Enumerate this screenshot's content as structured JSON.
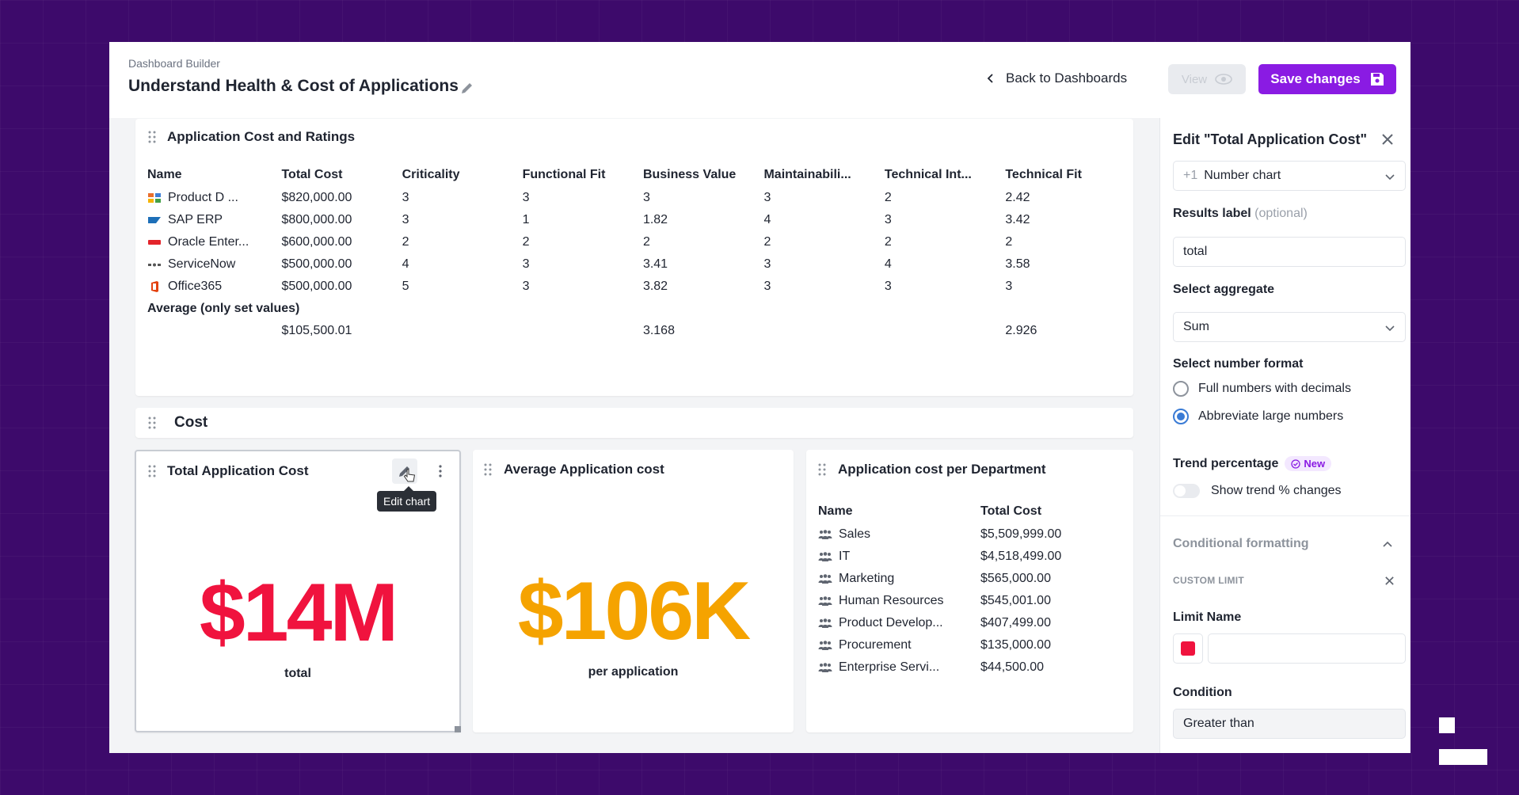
{
  "header": {
    "breadcrumb": "Dashboard Builder",
    "title": "Understand Health & Cost of Applications",
    "back_label": "Back to Dashboards",
    "view_label": "View",
    "save_label": "Save changes"
  },
  "ratings_panel": {
    "title": "Application Cost and Ratings",
    "columns": [
      "Name",
      "Total Cost",
      "Criticality",
      "Functional Fit",
      "Business Value",
      "Maintainabili...",
      "Technical Int...",
      "Technical Fit"
    ],
    "rows": [
      {
        "logo": "product-logo",
        "cells": [
          "Product D ...",
          "$820,000.00",
          "3",
          "3",
          "3",
          "3",
          "2",
          "2.42"
        ]
      },
      {
        "logo": "sap-logo",
        "cells": [
          "SAP ERP",
          "$800,000.00",
          "3",
          "1",
          "1.82",
          "4",
          "3",
          "3.42"
        ]
      },
      {
        "logo": "oracle-logo",
        "cells": [
          "Oracle Enter...",
          "$600,000.00",
          "2",
          "2",
          "2",
          "2",
          "2",
          "2"
        ]
      },
      {
        "logo": "servicenow-logo",
        "cells": [
          "ServiceNow",
          "$500,000.00",
          "4",
          "3",
          "3.41",
          "3",
          "4",
          "3.58"
        ]
      },
      {
        "logo": "office365-logo",
        "cells": [
          "Office365",
          "$500,000.00",
          "5",
          "3",
          "3.82",
          "3",
          "3",
          "3"
        ]
      }
    ],
    "average_label": "Average (only set values)",
    "average_values": [
      "",
      "$105,500.01",
      "",
      "",
      "3.168",
      "",
      "",
      "2.926"
    ]
  },
  "section_cost": {
    "title": "Cost"
  },
  "total_cost_card": {
    "title": "Total Application Cost",
    "value": "$14M",
    "caption": "total",
    "tooltip": "Edit chart",
    "value_color": "#f0133e"
  },
  "average_cost_card": {
    "title": "Average Application cost",
    "value": "$106K",
    "caption": "per application",
    "value_color": "#f5a300"
  },
  "department_card": {
    "title": "Application cost per Department",
    "columns": [
      "Name",
      "Total Cost"
    ],
    "rows": [
      [
        "Sales",
        "$5,509,999.00"
      ],
      [
        "IT",
        "$4,518,499.00"
      ],
      [
        "Marketing",
        "$565,000.00"
      ],
      [
        "Human Resources",
        "$545,001.00"
      ],
      [
        "Product Develop...",
        "$407,499.00"
      ],
      [
        "Procurement",
        "$135,000.00"
      ],
      [
        "Enterprise Servi...",
        "$44,500.00"
      ]
    ]
  },
  "edit_panel": {
    "title": "Edit \"Total Application Cost\"",
    "chart_type_prefix": "+1",
    "chart_type": "Number chart",
    "results_label_title": "Results label",
    "results_label_optional": "(optional)",
    "results_label_value": "total",
    "aggregate_title": "Select aggregate",
    "aggregate_value": "Sum",
    "number_format_title": "Select number format",
    "number_format_options": [
      {
        "label": "Full numbers with decimals",
        "selected": false
      },
      {
        "label": "Abbreviate large numbers",
        "selected": true
      }
    ],
    "trend_title": "Trend percentage",
    "trend_badge": "New",
    "trend_toggle_label": "Show trend % changes",
    "trend_enabled": false,
    "conditional_title": "Conditional formatting",
    "custom_limit_label": "CUSTOM LIMIT",
    "limit_name_title": "Limit Name",
    "limit_color": "#f0133e",
    "limit_name_value": "",
    "condition_title": "Condition",
    "condition_value": "Greater than"
  },
  "colors": {
    "brand": "#8a1be3",
    "background": "#3d0a6b"
  }
}
